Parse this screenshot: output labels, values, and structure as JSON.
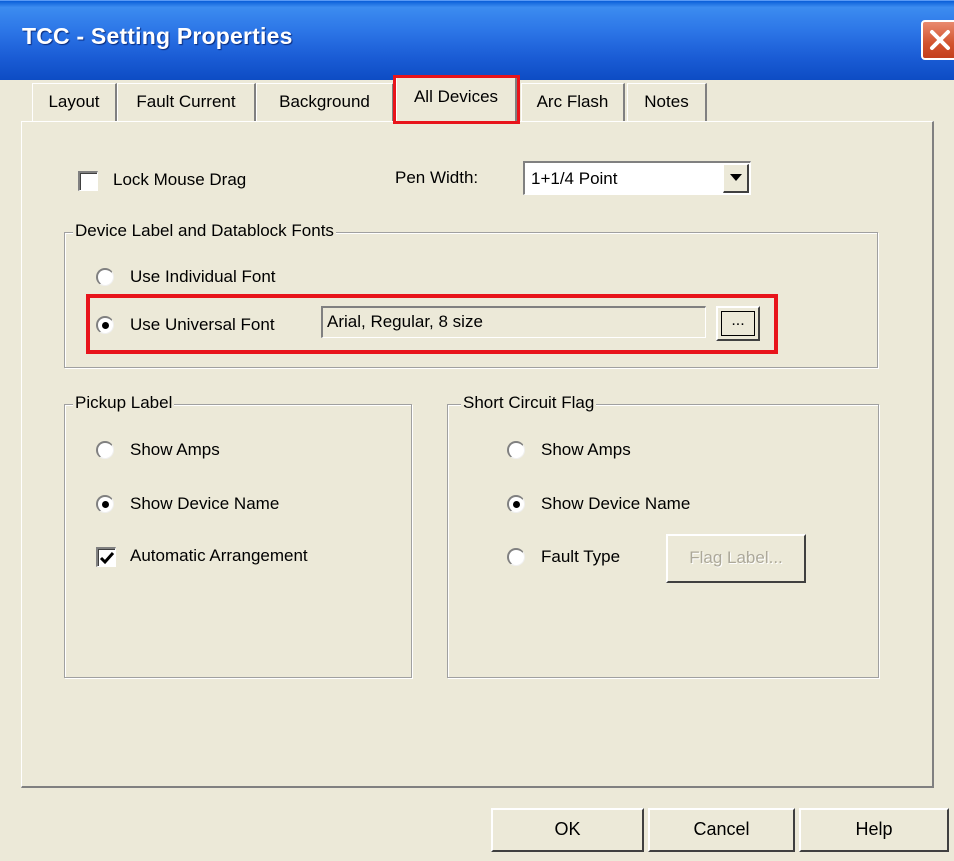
{
  "window": {
    "title": "TCC - Setting Properties"
  },
  "tabs": [
    {
      "label": "Layout"
    },
    {
      "label": "Fault Current"
    },
    {
      "label": "Background"
    },
    {
      "label": "All Devices"
    },
    {
      "label": "Arc Flash"
    },
    {
      "label": "Notes"
    }
  ],
  "active_tab": "All Devices",
  "lock_mouse_drag": {
    "label": "Lock Mouse Drag",
    "checked": false
  },
  "pen_width": {
    "label": "Pen Width:",
    "value": "1+1/4 Point"
  },
  "device_fonts": {
    "title": "Device Label and Datablock Fonts",
    "individual_label": "Use Individual Font",
    "universal_label": "Use Universal Font",
    "selected": "universal",
    "font_value": "Arial, Regular, 8 size",
    "browse_label": "..."
  },
  "pickup_label": {
    "title": "Pickup Label",
    "show_amps": "Show Amps",
    "show_device_name": "Show Device Name",
    "selected": "show_device_name",
    "auto_arrange": {
      "label": "Automatic Arrangement",
      "checked": true
    }
  },
  "short_circuit_flag": {
    "title": "Short Circuit Flag",
    "show_amps": "Show Amps",
    "show_device_name": "Show Device Name",
    "fault_type": "Fault Type",
    "selected": "show_device_name",
    "flag_label_button": "Flag Label..."
  },
  "footer": {
    "ok": "OK",
    "cancel": "Cancel",
    "help": "Help"
  },
  "colors": {
    "title_bar": "#2b74e6",
    "dialog_bg": "#ece9d8",
    "highlight": "#e8141b",
    "disabled_text": "#aca899"
  }
}
